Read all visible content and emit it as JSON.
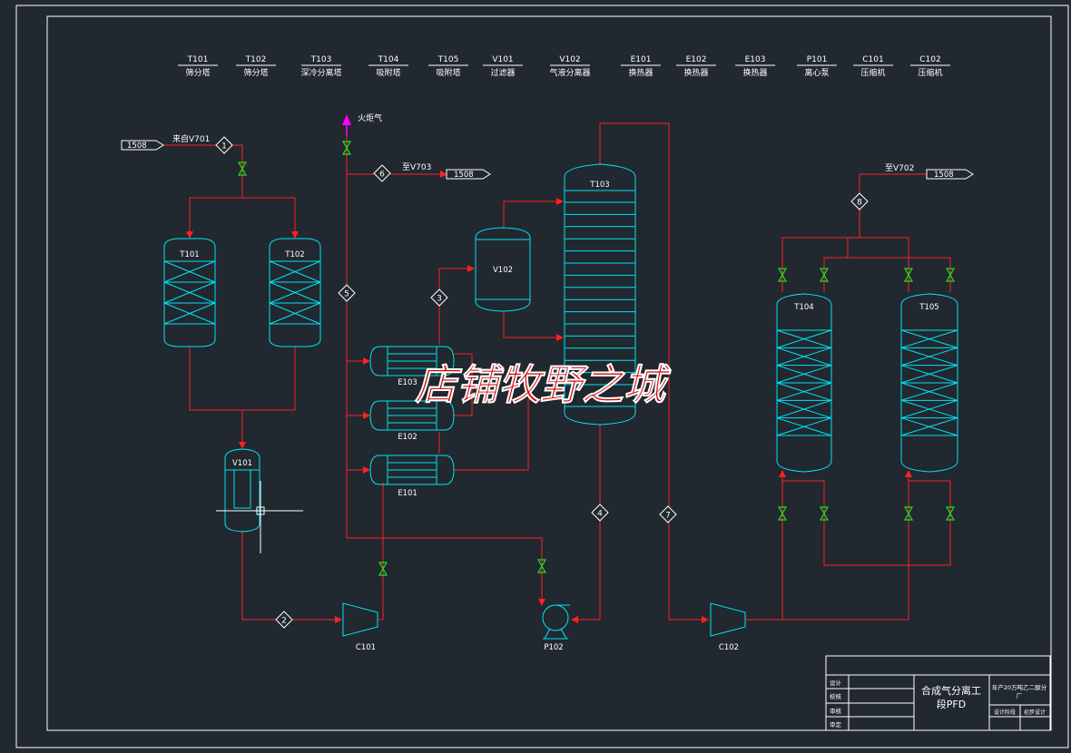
{
  "legend": [
    {
      "tag": "T101",
      "desc": "筛分塔"
    },
    {
      "tag": "T102",
      "desc": "筛分塔"
    },
    {
      "tag": "T103",
      "desc": "深冷分离塔"
    },
    {
      "tag": "T104",
      "desc": "吸附塔"
    },
    {
      "tag": "T105",
      "desc": "吸附塔"
    },
    {
      "tag": "V101",
      "desc": "过滤器"
    },
    {
      "tag": "V102",
      "desc": "气液分离器"
    },
    {
      "tag": "E101",
      "desc": "换热器"
    },
    {
      "tag": "E102",
      "desc": "换热器"
    },
    {
      "tag": "E103",
      "desc": "换热器"
    },
    {
      "tag": "P101",
      "desc": "离心泵"
    },
    {
      "tag": "C101",
      "desc": "压缩机"
    },
    {
      "tag": "C102",
      "desc": "压缩机"
    }
  ],
  "equipment": {
    "t101": "T101",
    "t102": "T102",
    "t103": "T103",
    "t104": "T104",
    "t105": "T105",
    "v101": "V101",
    "v102": "V102",
    "e101": "E101",
    "e102": "E102",
    "e103": "E103",
    "c101": "C101",
    "c102": "C102",
    "p102": "P102"
  },
  "streams": {
    "from_v701": "来自V701",
    "flare": "火炬气",
    "to_v703": "至V703",
    "to_v702": "至V702",
    "ref": "1508",
    "nums": [
      "1",
      "2",
      "3",
      "4",
      "5",
      "6",
      "7",
      "8"
    ]
  },
  "watermark": "店铺牧野之城",
  "title_block": {
    "labels": [
      "设计",
      "校核",
      "审核",
      "审定"
    ],
    "drawing_title": "合成气分离工段PFD",
    "project": "年产20万吨乙二醇分厂",
    "sub_left": "设计阶段",
    "sub_right": "初步设计"
  },
  "colors": {
    "equipment": "#00e5f0",
    "pipe": "#ff2020",
    "valve": "#20e020",
    "flare": "#ff00ff",
    "frame": "#ffffff",
    "watermark": "#d40000"
  }
}
